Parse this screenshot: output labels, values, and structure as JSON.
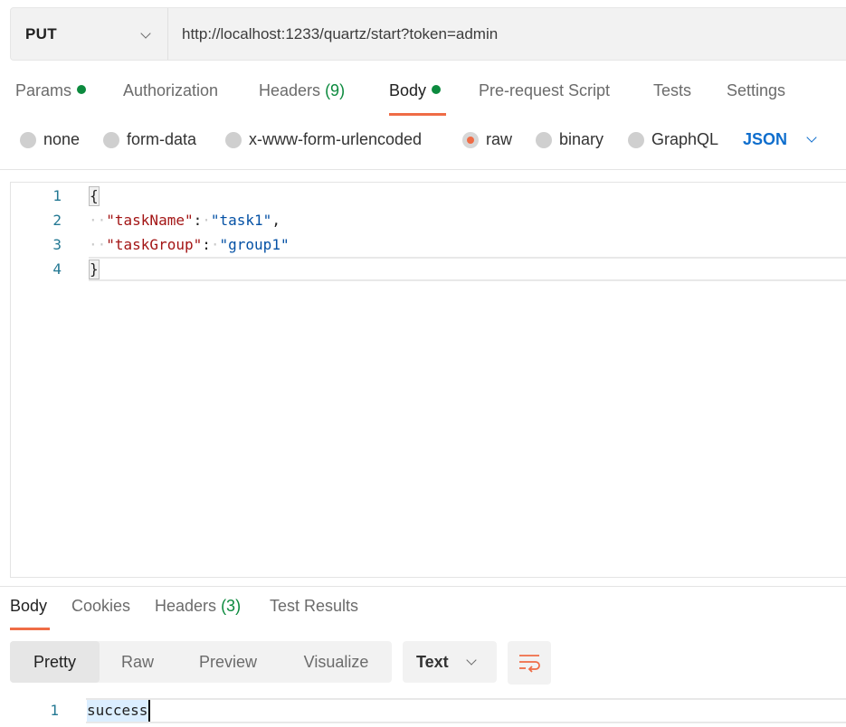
{
  "request": {
    "method": "PUT",
    "url": "http://localhost:1233/quartz/start?token=admin"
  },
  "request_tabs": {
    "params": "Params",
    "authorization": "Authorization",
    "headers": "Headers",
    "headers_count": "(9)",
    "body": "Body",
    "prerequest": "Pre-request Script",
    "tests": "Tests",
    "settings": "Settings"
  },
  "body_types": {
    "none": "none",
    "form_data": "form-data",
    "urlencoded": "x-www-form-urlencoded",
    "raw": "raw",
    "binary": "binary",
    "graphql": "GraphQL",
    "selected": "raw",
    "language": "JSON"
  },
  "editor": {
    "lines": [
      {
        "n": "1",
        "open": "{"
      },
      {
        "n": "2",
        "key": "\"taskName\"",
        "colon": ":",
        "value": "\"task1\"",
        "tail": ","
      },
      {
        "n": "3",
        "key": "\"taskGroup\"",
        "colon": ":",
        "value": "\"group1\"",
        "tail": ""
      },
      {
        "n": "4",
        "close": "}"
      }
    ]
  },
  "response_tabs": {
    "body": "Body",
    "cookies": "Cookies",
    "headers": "Headers",
    "headers_count": "(3)",
    "test_results": "Test Results"
  },
  "response_view": {
    "pretty": "Pretty",
    "raw": "Raw",
    "preview": "Preview",
    "visualize": "Visualize",
    "format": "Text"
  },
  "response": {
    "line_number": "1",
    "text": "success"
  },
  "colors": {
    "accent": "#ef6c46",
    "status_green": "#0c8a3e",
    "link_blue": "#0f6ecd"
  }
}
